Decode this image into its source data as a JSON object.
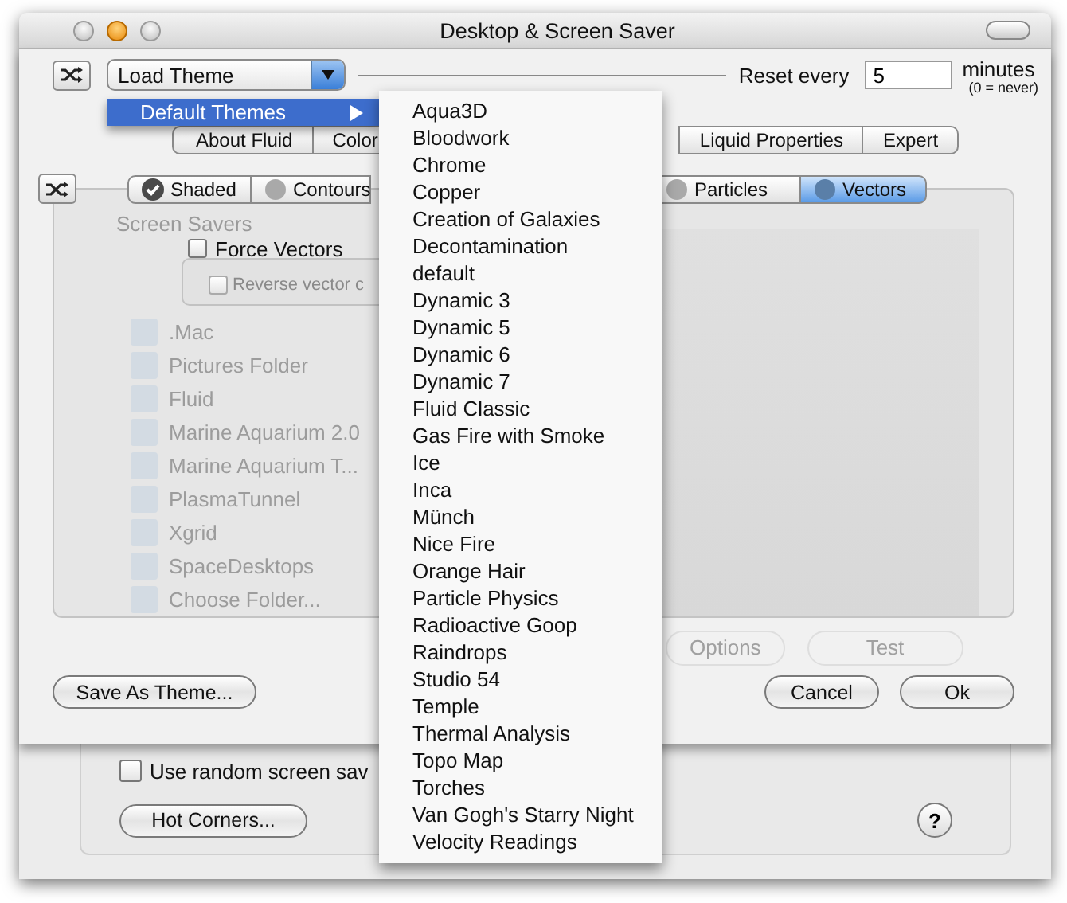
{
  "window": {
    "title": "Desktop & Screen Saver"
  },
  "theme_bar": {
    "popup": "Load Theme",
    "reset_label": "Reset every",
    "reset_value": "5",
    "unit": "minutes",
    "unit_note": "(0 = never)"
  },
  "tabs": [
    {
      "label": "About Fluid",
      "selected": false
    },
    {
      "label": "Color",
      "selected": false
    },
    {
      "label": "Liquid Properties",
      "selected": false
    },
    {
      "label": "Expert",
      "selected": false
    }
  ],
  "render_modes": [
    {
      "label": "Shaded",
      "checked": true,
      "selected": false
    },
    {
      "label": "Contours",
      "checked": false,
      "selected": false
    },
    {
      "label": "Particles",
      "checked": false,
      "selected": false
    },
    {
      "label": "Vectors",
      "checked": false,
      "selected": true
    }
  ],
  "screen_savers": {
    "header": "Screen Savers",
    "items": [
      ".Mac",
      "Pictures Folder",
      "Fluid",
      "Marine Aquarium 2.0",
      "Marine Aquarium T...",
      "PlasmaTunnel",
      "Xgrid",
      "SpaceDesktops",
      "Choose Folder..."
    ]
  },
  "options": [
    {
      "kind": "checkbox",
      "label": "Force Vectors",
      "checked": false,
      "disabled": false
    },
    {
      "kind": "checkbox",
      "label": "Reverse vector c",
      "checked": false,
      "disabled": true
    }
  ],
  "ghost_buttons": [
    "Options",
    "Test"
  ],
  "save_button": "Save As Theme...",
  "dialog_buttons": [
    {
      "label": "Cancel",
      "default": false
    },
    {
      "label": "Ok",
      "default": false
    }
  ],
  "lower": {
    "random": {
      "label": "Use random screen sav",
      "checked": false
    },
    "hot_corners": "Hot Corners...",
    "help": "?"
  },
  "menu": {
    "items": [
      {
        "label": "Default Themes",
        "selected": true
      }
    ]
  },
  "submenu": {
    "items": [
      "Aqua3D",
      "Bloodwork",
      "Chrome",
      "Copper",
      "Creation of Galaxies",
      "Decontamination",
      "default",
      "Dynamic 3",
      "Dynamic 5",
      "Dynamic 6",
      "Dynamic 7",
      "Fluid Classic",
      "Gas Fire with Smoke",
      "Ice",
      "Inca",
      "Münch",
      "Nice Fire",
      "Orange Hair",
      "Particle Physics",
      "Radioactive Goop",
      "Raindrops",
      "Studio 54",
      "Temple",
      "Thermal Analysis",
      "Topo Map",
      "Torches",
      "Van Gogh's Starry Night",
      "Velocity Readings"
    ]
  }
}
